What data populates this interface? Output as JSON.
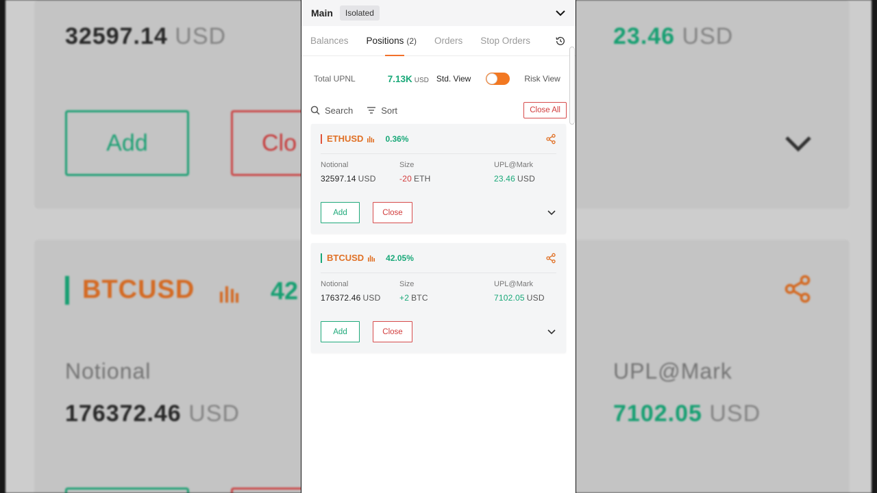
{
  "header": {
    "account": "Main",
    "mode": "Isolated"
  },
  "tabs": [
    {
      "label": "Balances"
    },
    {
      "label": "Positions",
      "count": "(2)"
    },
    {
      "label": "Orders"
    },
    {
      "label": "Stop Orders"
    }
  ],
  "summary": {
    "upnl_label": "Total UPNL",
    "upnl_value": "7.13K",
    "upnl_unit": "USD",
    "std_view": "Std. View",
    "risk_view": "Risk View",
    "toggle_on": true
  },
  "filter": {
    "search": "Search",
    "sort": "Sort",
    "close_all": "Close All"
  },
  "positions": [
    {
      "symbol": "ETHUSD",
      "pct": "0.36%",
      "side_color": "#e0533b",
      "notional_label": "Notional",
      "notional": "32597.14",
      "notional_unit": "USD",
      "size_label": "Size",
      "size": "-20",
      "size_unit": "ETH",
      "upl_label": "UPL@Mark",
      "upl": "23.46",
      "upl_unit": "USD",
      "add": "Add",
      "close": "Close"
    },
    {
      "symbol": "BTCUSD",
      "pct": "42.05%",
      "side_color": "#18a878",
      "notional_label": "Notional",
      "notional": "176372.46",
      "notional_unit": "USD",
      "size_label": "Size",
      "size": "+2",
      "size_unit": "BTC",
      "upl_label": "UPL@Mark",
      "upl": "7102.05",
      "upl_unit": "USD",
      "add": "Add",
      "close": "Close"
    }
  ],
  "background": {
    "notional_value": "32597.14",
    "notional_unit": "USD",
    "upl_value": "23.46",
    "upl_unit": "USD",
    "add": "Add",
    "close_partial": "Clo",
    "symbol": "BTCUSD",
    "pct_partial": "42",
    "notional_label": "Notional",
    "btc_notional": "176372.46",
    "btc_notional_unit": "USD",
    "upl_label": "UPL@Mark",
    "btc_upl": "7102.05",
    "btc_upl_unit": "USD"
  }
}
